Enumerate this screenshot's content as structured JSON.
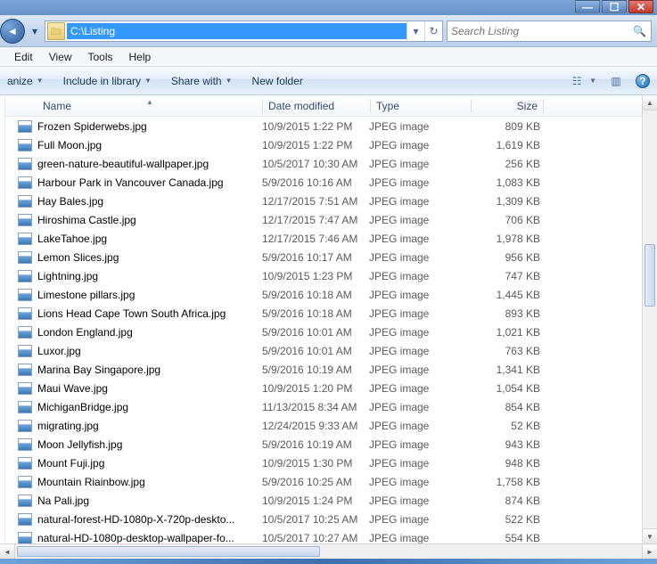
{
  "window": {
    "minimize_glyph": "—",
    "maximize_glyph": "☐",
    "close_glyph": "✕"
  },
  "address": {
    "path": "C:\\Listing",
    "refresh_glyph": "↻",
    "drop_glyph": "▾",
    "back_glyph": "◄",
    "nav_drop_glyph": "▾"
  },
  "search": {
    "placeholder": "Search Listing",
    "glyph": "🔍"
  },
  "menu": {
    "edit": "Edit",
    "view": "View",
    "tools": "Tools",
    "help": "Help"
  },
  "commands": {
    "organize": "anize",
    "include": "Include in library",
    "share": "Share with",
    "newfolder": "New folder",
    "views_glyph": "☷",
    "preview_glyph": "▥",
    "help_glyph": "?"
  },
  "columns": {
    "name": "Name",
    "date": "Date modified",
    "type": "Type",
    "size": "Size"
  },
  "files": [
    {
      "name": "Frozen Spiderwebs.jpg",
      "date": "10/9/2015 1:22 PM",
      "type": "JPEG image",
      "size": "809 KB"
    },
    {
      "name": "Full Moon.jpg",
      "date": "10/9/2015 1:22 PM",
      "type": "JPEG image",
      "size": "1,619 KB"
    },
    {
      "name": "green-nature-beautiful-wallpaper.jpg",
      "date": "10/5/2017 10:30 AM",
      "type": "JPEG image",
      "size": "256 KB"
    },
    {
      "name": "Harbour Park in Vancouver Canada.jpg",
      "date": "5/9/2016 10:16 AM",
      "type": "JPEG image",
      "size": "1,083 KB"
    },
    {
      "name": "Hay Bales.jpg",
      "date": "12/17/2015 7:51 AM",
      "type": "JPEG image",
      "size": "1,309 KB"
    },
    {
      "name": "Hiroshima Castle.jpg",
      "date": "12/17/2015 7:47 AM",
      "type": "JPEG image",
      "size": "706 KB"
    },
    {
      "name": "LakeTahoe.jpg",
      "date": "12/17/2015 7:46 AM",
      "type": "JPEG image",
      "size": "1,978 KB"
    },
    {
      "name": "Lemon Slices.jpg",
      "date": "5/9/2016 10:17 AM",
      "type": "JPEG image",
      "size": "956 KB"
    },
    {
      "name": "Lightning.jpg",
      "date": "10/9/2015 1:23 PM",
      "type": "JPEG image",
      "size": "747 KB"
    },
    {
      "name": "Limestone pillars.jpg",
      "date": "5/9/2016 10:18 AM",
      "type": "JPEG image",
      "size": "1,445 KB"
    },
    {
      "name": "Lions Head Cape Town South Africa.jpg",
      "date": "5/9/2016 10:18 AM",
      "type": "JPEG image",
      "size": "893 KB"
    },
    {
      "name": "London England.jpg",
      "date": "5/9/2016 10:01 AM",
      "type": "JPEG image",
      "size": "1,021 KB"
    },
    {
      "name": "Luxor.jpg",
      "date": "5/9/2016 10:01 AM",
      "type": "JPEG image",
      "size": "763 KB"
    },
    {
      "name": "Marina  Bay Singapore.jpg",
      "date": "5/9/2016 10:19 AM",
      "type": "JPEG image",
      "size": "1,341 KB"
    },
    {
      "name": "Maui Wave.jpg",
      "date": "10/9/2015 1:20 PM",
      "type": "JPEG image",
      "size": "1,054 KB"
    },
    {
      "name": "MichiganBridge.jpg",
      "date": "11/13/2015 8:34 AM",
      "type": "JPEG image",
      "size": "854 KB"
    },
    {
      "name": "migrating.jpg",
      "date": "12/24/2015 9:33 AM",
      "type": "JPEG image",
      "size": "52 KB"
    },
    {
      "name": "Moon Jellyfish.jpg",
      "date": "5/9/2016 10:19 AM",
      "type": "JPEG image",
      "size": "943 KB"
    },
    {
      "name": "Mount Fuji.jpg",
      "date": "10/9/2015 1:30 PM",
      "type": "JPEG image",
      "size": "948 KB"
    },
    {
      "name": "Mountain Riainbow.jpg",
      "date": "5/9/2016 10:25 AM",
      "type": "JPEG image",
      "size": "1,758 KB"
    },
    {
      "name": "Na Pali.jpg",
      "date": "10/9/2015 1:24 PM",
      "type": "JPEG image",
      "size": "874 KB"
    },
    {
      "name": "natural-forest-HD-1080p-X-720p-deskto...",
      "date": "10/5/2017 10:25 AM",
      "type": "JPEG image",
      "size": "522 KB"
    },
    {
      "name": "natural-HD-1080p-desktop-wallpaper-fo...",
      "date": "10/5/2017 10:27 AM",
      "type": "JPEG image",
      "size": "554 KB"
    }
  ]
}
